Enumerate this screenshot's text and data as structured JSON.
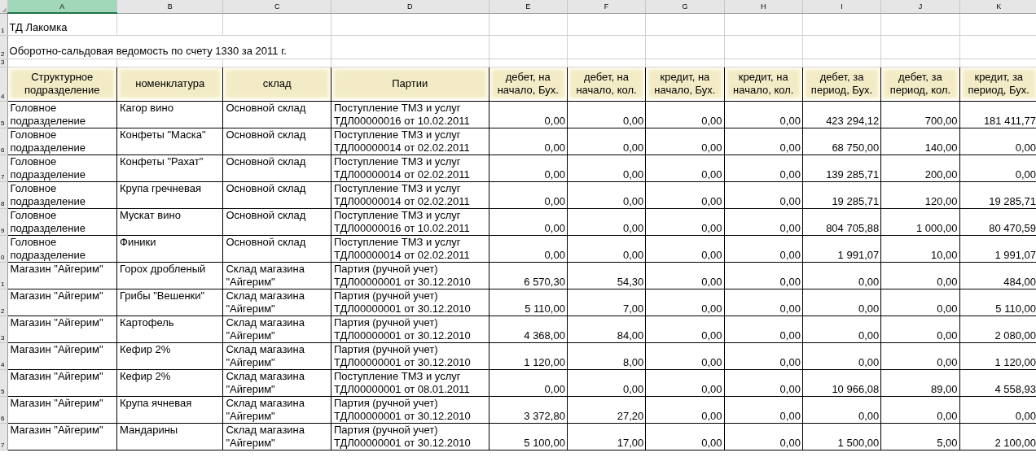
{
  "column_headers": [
    {
      "label": "A",
      "selected": true
    },
    {
      "label": "B",
      "selected": false
    },
    {
      "label": "C",
      "selected": false
    },
    {
      "label": "D",
      "selected": false
    },
    {
      "label": "E",
      "selected": false
    },
    {
      "label": "F",
      "selected": false
    },
    {
      "label": "G",
      "selected": false
    },
    {
      "label": "H",
      "selected": false
    },
    {
      "label": "I",
      "selected": false
    },
    {
      "label": "J",
      "selected": false
    },
    {
      "label": "K",
      "selected": false
    }
  ],
  "title_rows": [
    {
      "row_number": "1",
      "text": "ТД Лакомка"
    },
    {
      "row_number": "2",
      "text": "Оборотно-сальдовая ведомость по счету 1330 за 2011 г."
    }
  ],
  "blank_row_number": "3",
  "table": {
    "header_row_number": "4",
    "columns": [
      {
        "label": "Структурное подразделение",
        "kind": "text"
      },
      {
        "label": "номенклатура",
        "kind": "text"
      },
      {
        "label": "склад",
        "kind": "text"
      },
      {
        "label": "Партии",
        "kind": "text"
      },
      {
        "label": "дебет, на начало, Бух.",
        "kind": "number"
      },
      {
        "label": "дебет, на начало, кол.",
        "kind": "number"
      },
      {
        "label": "кредит, на начало, Бух.",
        "kind": "number"
      },
      {
        "label": "кредит, на начало, кол.",
        "kind": "number"
      },
      {
        "label": "дебет, за период, Бух.",
        "kind": "number"
      },
      {
        "label": "дебет, за период, кол.",
        "kind": "number"
      },
      {
        "label": "кредит, за период, Бух.",
        "kind": "number"
      }
    ],
    "rows": [
      {
        "row_number": "5",
        "cells": [
          "Головное подразделение",
          "Кагор вино",
          "Основной склад",
          "Поступление ТМЗ и услуг ТДЛ00000016 от 10.02.2011",
          "0,00",
          "0,00",
          "0,00",
          "0,00",
          "423 294,12",
          "700,00",
          "181 411,77"
        ]
      },
      {
        "row_number": "6",
        "cells": [
          "Головное подразделение",
          "Конфеты \"Маска\"",
          "Основной склад",
          "Поступление ТМЗ и услуг ТДЛ00000014 от 02.02.2011",
          "0,00",
          "0,00",
          "0,00",
          "0,00",
          "68 750,00",
          "140,00",
          "0,00"
        ]
      },
      {
        "row_number": "7",
        "cells": [
          "Головное подразделение",
          "Конфеты \"Рахат\"",
          "Основной склад",
          "Поступление ТМЗ и услуг ТДЛ00000014 от 02.02.2011",
          "0,00",
          "0,00",
          "0,00",
          "0,00",
          "139 285,71",
          "200,00",
          "0,00"
        ]
      },
      {
        "row_number": "8",
        "cells": [
          "Головное подразделение",
          "Крупа гречневая",
          "Основной склад",
          "Поступление ТМЗ и услуг ТДЛ00000014 от 02.02.2011",
          "0,00",
          "0,00",
          "0,00",
          "0,00",
          "19 285,71",
          "120,00",
          "19 285,71"
        ]
      },
      {
        "row_number": "9",
        "cells": [
          "Головное подразделение",
          "Мускат вино",
          "Основной склад",
          "Поступление ТМЗ и услуг ТДЛ00000016 от 10.02.2011",
          "0,00",
          "0,00",
          "0,00",
          "0,00",
          "804 705,88",
          "1 000,00",
          "80 470,59"
        ]
      },
      {
        "row_number": "0",
        "cells": [
          "Головное подразделение",
          "Финики",
          "Основной склад",
          "Поступление ТМЗ и услуг ТДЛ00000014 от 02.02.2011",
          "0,00",
          "0,00",
          "0,00",
          "0,00",
          "1 991,07",
          "10,00",
          "1 991,07"
        ]
      },
      {
        "row_number": "1",
        "cells": [
          "Магазин \"Айгерим\"",
          "Горох дробленый",
          "Склад магазина \"Айгерим\"",
          "Партия (ручной учет) ТДЛ00000001 от 30.12.2010",
          "6 570,30",
          "54,30",
          "0,00",
          "0,00",
          "0,00",
          "0,00",
          "484,00"
        ]
      },
      {
        "row_number": "2",
        "cells": [
          "Магазин \"Айгерим\"",
          "Грибы \"Вешенки\"",
          "Склад магазина \"Айгерим\"",
          "Партия (ручной учет) ТДЛ00000001 от 30.12.2010",
          "5 110,00",
          "7,00",
          "0,00",
          "0,00",
          "0,00",
          "0,00",
          "5 110,00"
        ]
      },
      {
        "row_number": "3",
        "cells": [
          "Магазин \"Айгерим\"",
          "Картофель",
          "Склад магазина \"Айгерим\"",
          "Партия (ручной учет) ТДЛ00000001 от 30.12.2010",
          "4 368,00",
          "84,00",
          "0,00",
          "0,00",
          "0,00",
          "0,00",
          "2 080,00"
        ]
      },
      {
        "row_number": "4",
        "cells": [
          "Магазин \"Айгерим\"",
          "Кефир 2%",
          "Склад магазина \"Айгерим\"",
          "Партия (ручной учет) ТДЛ00000001 от 30.12.2010",
          "1 120,00",
          "8,00",
          "0,00",
          "0,00",
          "0,00",
          "0,00",
          "1 120,00"
        ]
      },
      {
        "row_number": "5",
        "cells": [
          "Магазин \"Айгерим\"",
          "Кефир 2%",
          "Склад магазина \"Айгерим\"",
          "Поступление ТМЗ и услуг ТДЛ00000001 от 08.01.2011",
          "0,00",
          "0,00",
          "0,00",
          "0,00",
          "10 966,08",
          "89,00",
          "4 558,93"
        ]
      },
      {
        "row_number": "6",
        "cells": [
          "Магазин \"Айгерим\"",
          "Крупа ячневая",
          "Склад магазина \"Айгерим\"",
          "Партия (ручной учет) ТДЛ00000001 от 30.12.2010",
          "3 372,80",
          "27,20",
          "0,00",
          "0,00",
          "0,00",
          "0,00",
          "0,00"
        ]
      },
      {
        "row_number": "7",
        "cells": [
          "Магазин \"Айгерим\"",
          "Мандарины",
          "Склад магазина \"Айгерим\"",
          "Партия (ручной учет) ТДЛ00000001 от 30.12.2010",
          "5 100,00",
          "17,00",
          "0,00",
          "0,00",
          "1 500,00",
          "5,00",
          "2 100,00"
        ]
      }
    ]
  }
}
